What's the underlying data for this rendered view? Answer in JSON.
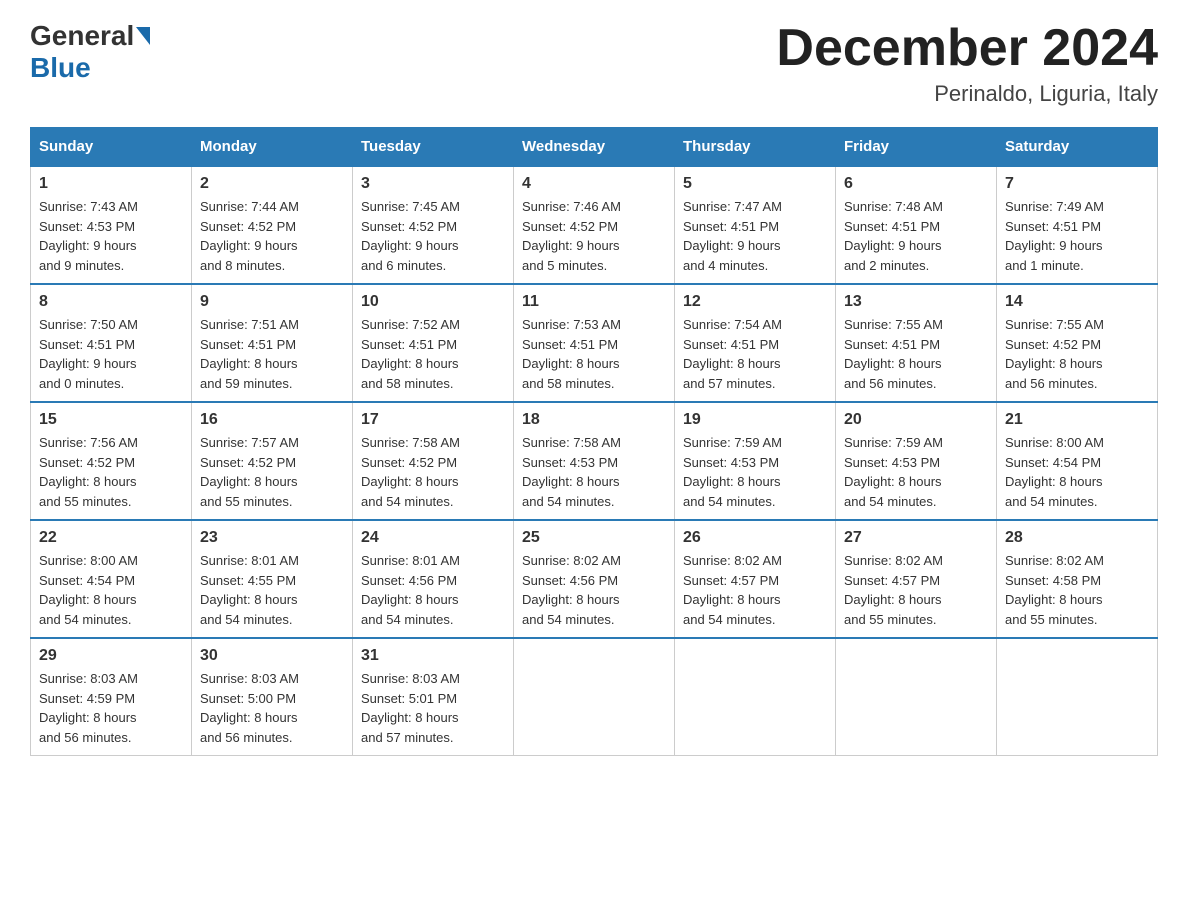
{
  "logo": {
    "general": "General",
    "blue": "Blue"
  },
  "title": "December 2024",
  "subtitle": "Perinaldo, Liguria, Italy",
  "headers": [
    "Sunday",
    "Monday",
    "Tuesday",
    "Wednesday",
    "Thursday",
    "Friday",
    "Saturday"
  ],
  "weeks": [
    [
      {
        "day": "1",
        "info": "Sunrise: 7:43 AM\nSunset: 4:53 PM\nDaylight: 9 hours\nand 9 minutes."
      },
      {
        "day": "2",
        "info": "Sunrise: 7:44 AM\nSunset: 4:52 PM\nDaylight: 9 hours\nand 8 minutes."
      },
      {
        "day": "3",
        "info": "Sunrise: 7:45 AM\nSunset: 4:52 PM\nDaylight: 9 hours\nand 6 minutes."
      },
      {
        "day": "4",
        "info": "Sunrise: 7:46 AM\nSunset: 4:52 PM\nDaylight: 9 hours\nand 5 minutes."
      },
      {
        "day": "5",
        "info": "Sunrise: 7:47 AM\nSunset: 4:51 PM\nDaylight: 9 hours\nand 4 minutes."
      },
      {
        "day": "6",
        "info": "Sunrise: 7:48 AM\nSunset: 4:51 PM\nDaylight: 9 hours\nand 2 minutes."
      },
      {
        "day": "7",
        "info": "Sunrise: 7:49 AM\nSunset: 4:51 PM\nDaylight: 9 hours\nand 1 minute."
      }
    ],
    [
      {
        "day": "8",
        "info": "Sunrise: 7:50 AM\nSunset: 4:51 PM\nDaylight: 9 hours\nand 0 minutes."
      },
      {
        "day": "9",
        "info": "Sunrise: 7:51 AM\nSunset: 4:51 PM\nDaylight: 8 hours\nand 59 minutes."
      },
      {
        "day": "10",
        "info": "Sunrise: 7:52 AM\nSunset: 4:51 PM\nDaylight: 8 hours\nand 58 minutes."
      },
      {
        "day": "11",
        "info": "Sunrise: 7:53 AM\nSunset: 4:51 PM\nDaylight: 8 hours\nand 58 minutes."
      },
      {
        "day": "12",
        "info": "Sunrise: 7:54 AM\nSunset: 4:51 PM\nDaylight: 8 hours\nand 57 minutes."
      },
      {
        "day": "13",
        "info": "Sunrise: 7:55 AM\nSunset: 4:51 PM\nDaylight: 8 hours\nand 56 minutes."
      },
      {
        "day": "14",
        "info": "Sunrise: 7:55 AM\nSunset: 4:52 PM\nDaylight: 8 hours\nand 56 minutes."
      }
    ],
    [
      {
        "day": "15",
        "info": "Sunrise: 7:56 AM\nSunset: 4:52 PM\nDaylight: 8 hours\nand 55 minutes."
      },
      {
        "day": "16",
        "info": "Sunrise: 7:57 AM\nSunset: 4:52 PM\nDaylight: 8 hours\nand 55 minutes."
      },
      {
        "day": "17",
        "info": "Sunrise: 7:58 AM\nSunset: 4:52 PM\nDaylight: 8 hours\nand 54 minutes."
      },
      {
        "day": "18",
        "info": "Sunrise: 7:58 AM\nSunset: 4:53 PM\nDaylight: 8 hours\nand 54 minutes."
      },
      {
        "day": "19",
        "info": "Sunrise: 7:59 AM\nSunset: 4:53 PM\nDaylight: 8 hours\nand 54 minutes."
      },
      {
        "day": "20",
        "info": "Sunrise: 7:59 AM\nSunset: 4:53 PM\nDaylight: 8 hours\nand 54 minutes."
      },
      {
        "day": "21",
        "info": "Sunrise: 8:00 AM\nSunset: 4:54 PM\nDaylight: 8 hours\nand 54 minutes."
      }
    ],
    [
      {
        "day": "22",
        "info": "Sunrise: 8:00 AM\nSunset: 4:54 PM\nDaylight: 8 hours\nand 54 minutes."
      },
      {
        "day": "23",
        "info": "Sunrise: 8:01 AM\nSunset: 4:55 PM\nDaylight: 8 hours\nand 54 minutes."
      },
      {
        "day": "24",
        "info": "Sunrise: 8:01 AM\nSunset: 4:56 PM\nDaylight: 8 hours\nand 54 minutes."
      },
      {
        "day": "25",
        "info": "Sunrise: 8:02 AM\nSunset: 4:56 PM\nDaylight: 8 hours\nand 54 minutes."
      },
      {
        "day": "26",
        "info": "Sunrise: 8:02 AM\nSunset: 4:57 PM\nDaylight: 8 hours\nand 54 minutes."
      },
      {
        "day": "27",
        "info": "Sunrise: 8:02 AM\nSunset: 4:57 PM\nDaylight: 8 hours\nand 55 minutes."
      },
      {
        "day": "28",
        "info": "Sunrise: 8:02 AM\nSunset: 4:58 PM\nDaylight: 8 hours\nand 55 minutes."
      }
    ],
    [
      {
        "day": "29",
        "info": "Sunrise: 8:03 AM\nSunset: 4:59 PM\nDaylight: 8 hours\nand 56 minutes."
      },
      {
        "day": "30",
        "info": "Sunrise: 8:03 AM\nSunset: 5:00 PM\nDaylight: 8 hours\nand 56 minutes."
      },
      {
        "day": "31",
        "info": "Sunrise: 8:03 AM\nSunset: 5:01 PM\nDaylight: 8 hours\nand 57 minutes."
      },
      {
        "day": "",
        "info": ""
      },
      {
        "day": "",
        "info": ""
      },
      {
        "day": "",
        "info": ""
      },
      {
        "day": "",
        "info": ""
      }
    ]
  ]
}
